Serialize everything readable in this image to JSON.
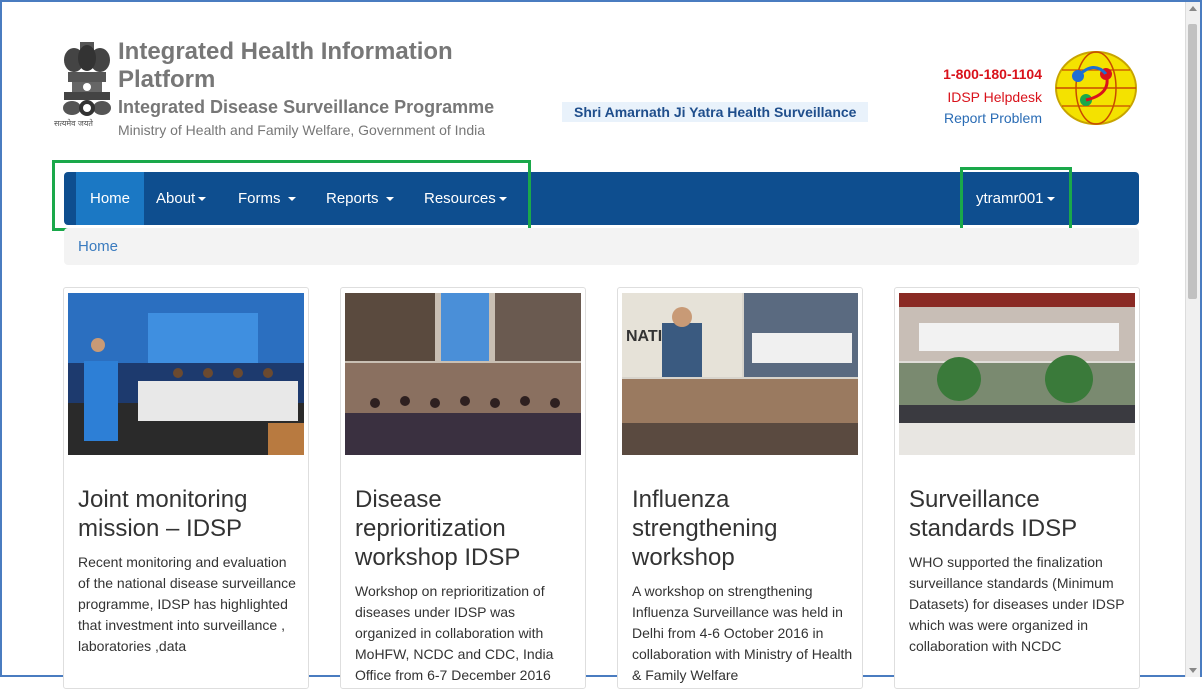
{
  "header": {
    "title_line1": "Integrated Health Information",
    "title_line2": "Platform",
    "subtitle": "Integrated Disease Surveillance Programme",
    "ministry": "Ministry of Health and Family Welfare, Government of India",
    "emblem_caption": "सत्यमेव जयते",
    "yatra_label": "Shri Amarnath Ji Yatra Health Surveillance",
    "phone": "1-800-180-1104",
    "helpdesk": "IDSP Helpdesk",
    "report_problem": "Report Problem"
  },
  "nav": {
    "home": "Home",
    "about": "About",
    "forms": "Forms",
    "reports": "Reports",
    "resources": "Resources",
    "user": "ytramr001"
  },
  "breadcrumb": {
    "current": "Home"
  },
  "cards": [
    {
      "title": "Joint monitoring mission – IDSP",
      "text": "Recent monitoring and evaluation of the national disease surveillance programme, IDSP has highlighted that investment into surveillance , laboratories ,data"
    },
    {
      "title": "Disease reprioritization workshop IDSP",
      "text": "Workshop on reprioritization of diseases under IDSP was organized in collaboration with MoHFW, NCDC and CDC, India Office from 6-7 December 2016"
    },
    {
      "title": "Influenza strengthening workshop",
      "text": "A workshop on strengthening Influenza Surveillance was held in Delhi from 4-6 October 2016 in collaboration with Ministry of Health & Family Welfare"
    },
    {
      "title": "Surveillance standards IDSP",
      "text": "WHO supported the finalization surveillance standards (Minimum Datasets) for diseases under IDSP which was were organized in collaboration with NCDC"
    }
  ],
  "colors": {
    "navbar": "#0e4e8f",
    "nav_active": "#1b78c4",
    "highlight": "#1aa84a",
    "phone": "#d9121b",
    "link": "#2a6cb5"
  }
}
